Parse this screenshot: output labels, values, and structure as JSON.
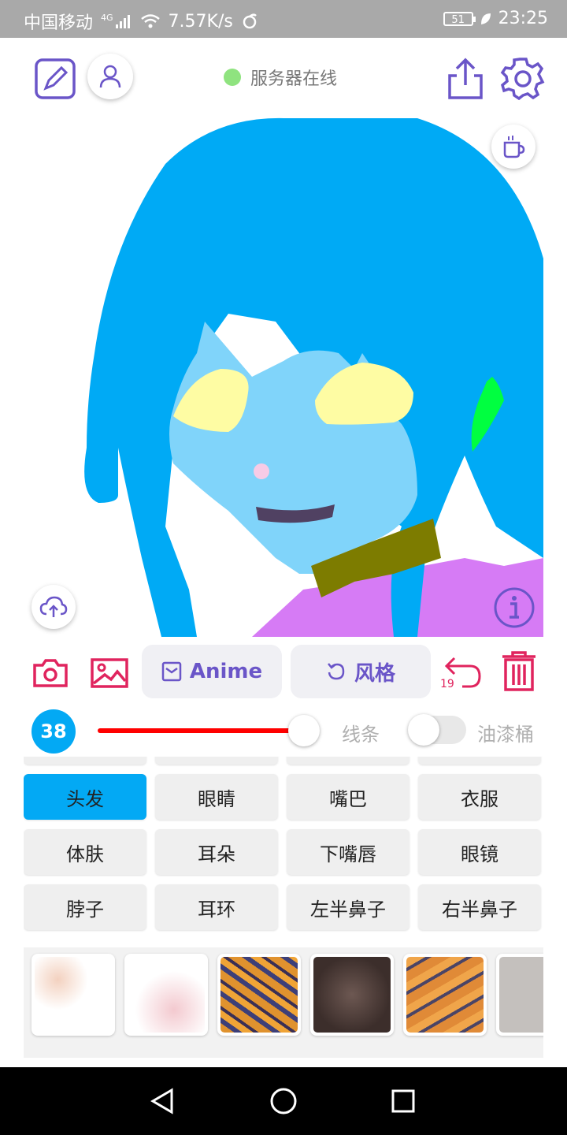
{
  "status_bar": {
    "carrier": "中国移动",
    "network": "4G",
    "speed": "7.57K/s",
    "battery": "51",
    "time": "23:25"
  },
  "header": {
    "server_status": "服务器在线",
    "server_status_color": "#8fe37f"
  },
  "toolbar": {
    "anime_label": "Anime",
    "style_label": "风格",
    "undo_count": "19"
  },
  "brush": {
    "size": "38",
    "size_slider_fraction": 0.9,
    "lines_label": "线条",
    "bucket_label": "油漆桶",
    "bucket_enabled": false
  },
  "parts": {
    "items": [
      "头发",
      "眼睛",
      "嘴巴",
      "衣服",
      "体肤",
      "耳朵",
      "下嘴唇",
      "眼镜",
      "脖子",
      "耳环",
      "左半鼻子",
      "右半鼻子"
    ],
    "selected": "头发"
  },
  "colors": {
    "accent": "#6a55c8",
    "danger": "#e0245e",
    "selected_part": "#03a9f4",
    "slider": "#ff0000",
    "hair": "#00aaf5",
    "skin": "#80d4fa",
    "eyes": "#fefca3",
    "mouth": "#504162",
    "neck": "#7d7c00",
    "clothes": "#d67bf5",
    "ear": "#00ff40"
  },
  "icons": {
    "top_left": [
      "sketch-edit-icon",
      "user-icon"
    ],
    "top_right": [
      "share-icon",
      "settings-icon"
    ],
    "canvas": [
      "coffee-icon",
      "cloud-upload-icon",
      "info-icon"
    ],
    "toolbar": [
      "camera-icon",
      "image-icon",
      "undo-icon",
      "trash-icon"
    ]
  }
}
